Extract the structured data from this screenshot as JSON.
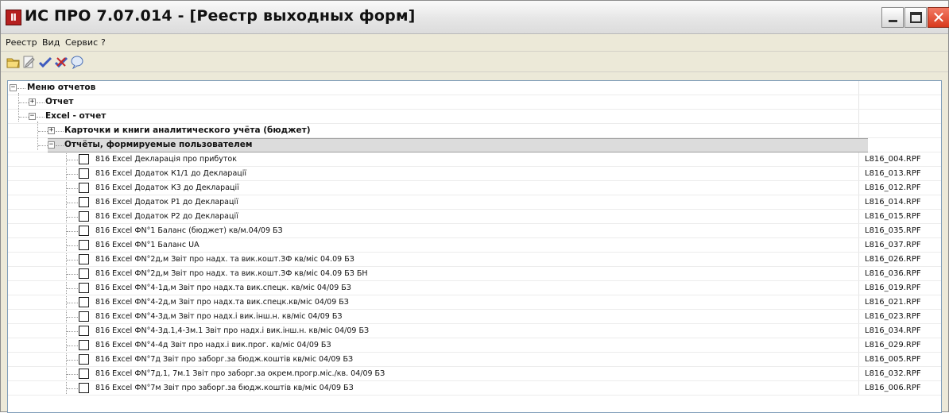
{
  "window": {
    "title": "ИС ПРО 7.07.014 - [Реестр выходных форм]",
    "icon": "app-icon",
    "icon_glyph": "Ⅱ"
  },
  "menu": [
    "Реестр",
    "Вид",
    "Сервис",
    "?"
  ],
  "toolbar": [
    {
      "icon": "open-folder-icon"
    },
    {
      "icon": "edit-document-icon"
    },
    {
      "icon": "check-icon"
    },
    {
      "icon": "uncheck-icon"
    },
    {
      "icon": "comment-icon"
    }
  ],
  "tree": {
    "root": "Меню отчетов",
    "nodes": [
      {
        "label": "Отчет",
        "expanded": false
      },
      {
        "label": "Excel - отчет",
        "expanded": true
      },
      {
        "label": "Карточки и книги аналитического учёта (бюджет)",
        "expanded": false
      },
      {
        "label": "Отчёты, формируемые пользователем",
        "expanded": true,
        "selected": true
      }
    ],
    "items": [
      {
        "name": "816 Excel Декларація про прибуток",
        "file": "L816_004.RPF"
      },
      {
        "name": "816 Excel Додаток К1/1 до Декларації",
        "file": "L816_013.RPF"
      },
      {
        "name": "816 Excel Додаток К3 до Декларації",
        "file": "L816_012.RPF"
      },
      {
        "name": "816 Excel Додаток Р1 до Декларації",
        "file": "L816_014.RPF"
      },
      {
        "name": "816 Excel Додаток Р2 до Декларації",
        "file": "L816_015.RPF"
      },
      {
        "name": "816 Excel ФN°1 Баланс (бюджет) кв/м.04/09 БЗ",
        "file": "L816_035.RPF"
      },
      {
        "name": "816 Excel ФN°1 Баланс UA",
        "file": "L816_037.RPF"
      },
      {
        "name": "816 Excel ФN°2д,м Звіт про надх. та вик.кошт.ЗФ кв/міс 04.09 БЗ",
        "file": "L816_026.RPF"
      },
      {
        "name": "816 Excel ФN°2д,м Звіт про надх. та вик.кошт.ЗФ кв/міс 04.09 БЗ БН",
        "file": "L816_036.RPF"
      },
      {
        "name": "816 Excel ФN°4-1д,м Звіт про надх.та вик.спецк. кв/міс 04/09 БЗ",
        "file": "L816_019.RPF"
      },
      {
        "name": "816 Excel ФN°4-2д,м Звіт про надх.та вик.спецк.кв/міс 04/09 БЗ",
        "file": "L816_021.RPF"
      },
      {
        "name": "816 Excel ФN°4-3д,м Звіт про надх.і вик.інш.н. кв/міс 04/09 БЗ",
        "file": "L816_023.RPF"
      },
      {
        "name": "816 Excel ФN°4-3д.1,4-3м.1 Звіт про надх.і вик.інш.н. кв/міс 04/09 БЗ",
        "file": "L816_034.RPF"
      },
      {
        "name": "816 Excel ФN°4-4д Звіт про надх.і вик.прог. кв/міс 04/09 БЗ",
        "file": "L816_029.RPF"
      },
      {
        "name": "816 Excel ФN°7д Звіт про заборг.за бюдж.коштів кв/міс 04/09 БЗ",
        "file": "L816_005.RPF"
      },
      {
        "name": "816 Excel ФN°7д.1, 7м.1 Звіт про заборг.за окрем.прогр.міс./кв. 04/09 БЗ",
        "file": "L816_032.RPF"
      },
      {
        "name": "816 Excel ФN°7м Звіт про заборг.за бюдж.коштів кв/міс 04/09 БЗ",
        "file": "L816_006.RPF"
      }
    ]
  }
}
